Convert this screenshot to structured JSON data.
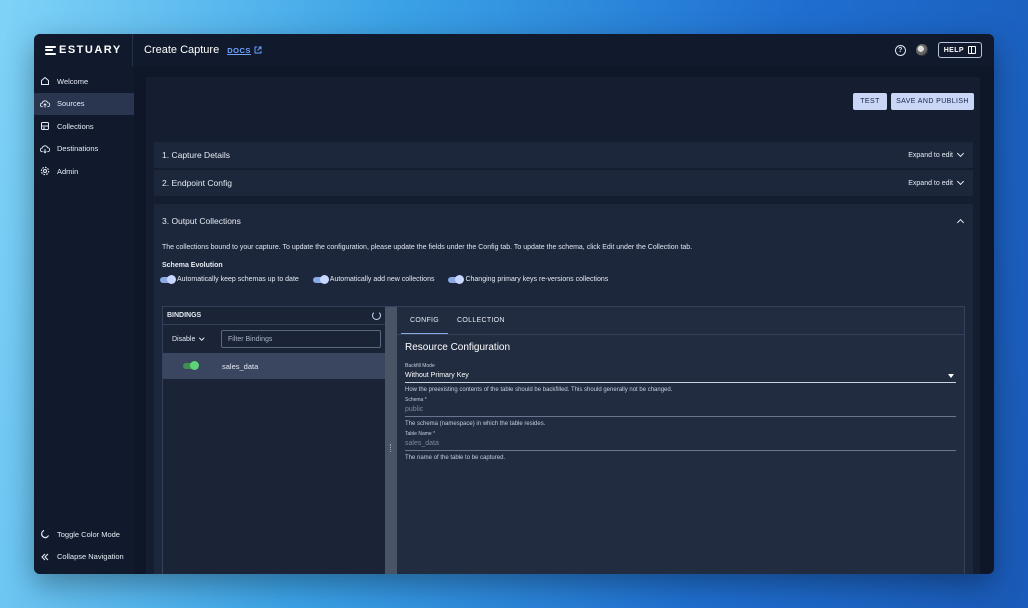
{
  "topbar": {
    "logo": "ESTUARY",
    "title": "Create Capture",
    "docs": "DOCS",
    "help": "HELP"
  },
  "sidebar": {
    "items": [
      {
        "label": "Welcome",
        "icon": "home-icon"
      },
      {
        "label": "Sources",
        "icon": "cloud-upload-icon",
        "active": true
      },
      {
        "label": "Collections",
        "icon": "database-icon"
      },
      {
        "label": "Destinations",
        "icon": "cloud-download-icon"
      },
      {
        "label": "Admin",
        "icon": "gear-icon"
      }
    ],
    "bottom": [
      {
        "label": "Toggle Color Mode",
        "icon": "moon-icon"
      },
      {
        "label": "Collapse Navigation",
        "icon": "double-chevron-left-icon"
      }
    ]
  },
  "actions": {
    "test": "TEST",
    "save": "SAVE AND PUBLISH"
  },
  "sections": {
    "capture_details": {
      "title": "1. Capture Details",
      "action": "Expand to edit"
    },
    "endpoint_config": {
      "title": "2. Endpoint Config",
      "action": "Expand to edit"
    },
    "output": {
      "title": "3. Output Collections",
      "description": "The collections bound to your capture. To update the configuration, please update the fields under the Config tab. To update the schema, click Edit under the Collection tab.",
      "schema_title": "Schema Evolution",
      "toggles": [
        "Automatically keep schemas up to date",
        "Automatically add new collections",
        "Changing primary keys re-versions collections"
      ]
    }
  },
  "bindings": {
    "header": "BINDINGS",
    "disable": "Disable",
    "filter_placeholder": "Filter Bindings",
    "rows": [
      {
        "name": "sales_data",
        "enabled": true
      }
    ]
  },
  "resource": {
    "tabs": [
      "CONFIG",
      "COLLECTION"
    ],
    "title": "Resource Configuration",
    "backfill": {
      "label": "Backfill Mode",
      "value": "Without Primary Key",
      "help": "How the preexisting contents of the table should be backfilled. This should generally not be changed."
    },
    "schema": {
      "label": "Schema *",
      "value": "public",
      "help": "The schema (namespace) in which the table resides."
    },
    "table": {
      "label": "Table Name *",
      "value": "sales_data",
      "help": "The name of the table to be captured."
    }
  },
  "colors": {
    "accent": "#8da8e6",
    "button": "#c9d6f5",
    "success": "#5fd37a"
  }
}
